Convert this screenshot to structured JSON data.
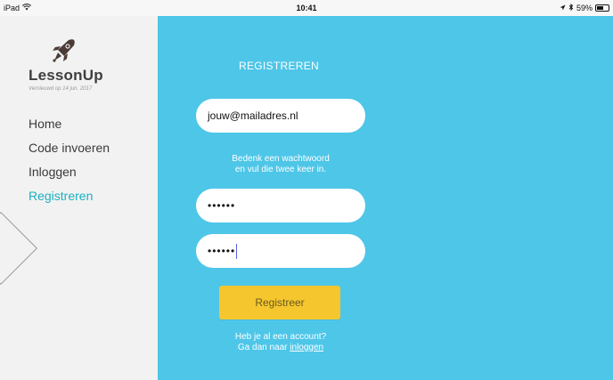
{
  "statusbar": {
    "device": "iPad",
    "time": "10:41",
    "battery_percent": "59%",
    "wifi_icon": "wifi-icon",
    "location_icon": "location-arrow-icon",
    "bluetooth_icon": "bluetooth-icon"
  },
  "sidebar": {
    "brand_name": "LessonUp",
    "updated_text": "Vernieuwd op 14 jun. 2017",
    "logo_icon": "rocket-icon",
    "items": [
      {
        "label": "Home",
        "active": false
      },
      {
        "label": "Code invoeren",
        "active": false
      },
      {
        "label": "Inloggen",
        "active": false
      },
      {
        "label": "Registreren",
        "active": true
      }
    ],
    "active_color": "#19b2c0"
  },
  "main": {
    "title": "REGISTREREN",
    "email_value": "jouw@mailadres.nl",
    "hint_line1": "Bedenk een wachtwoord",
    "hint_line2": "en vul die twee keer in.",
    "password1_mask": "••••••",
    "password2_mask": "••••••",
    "submit_label": "Registreer",
    "account_question": "Heb je al een account?",
    "account_go_prefix": "Ga dan naar",
    "login_link_label": "inloggen",
    "background_color": "#4ec6e8",
    "button_color": "#f5c62e"
  }
}
